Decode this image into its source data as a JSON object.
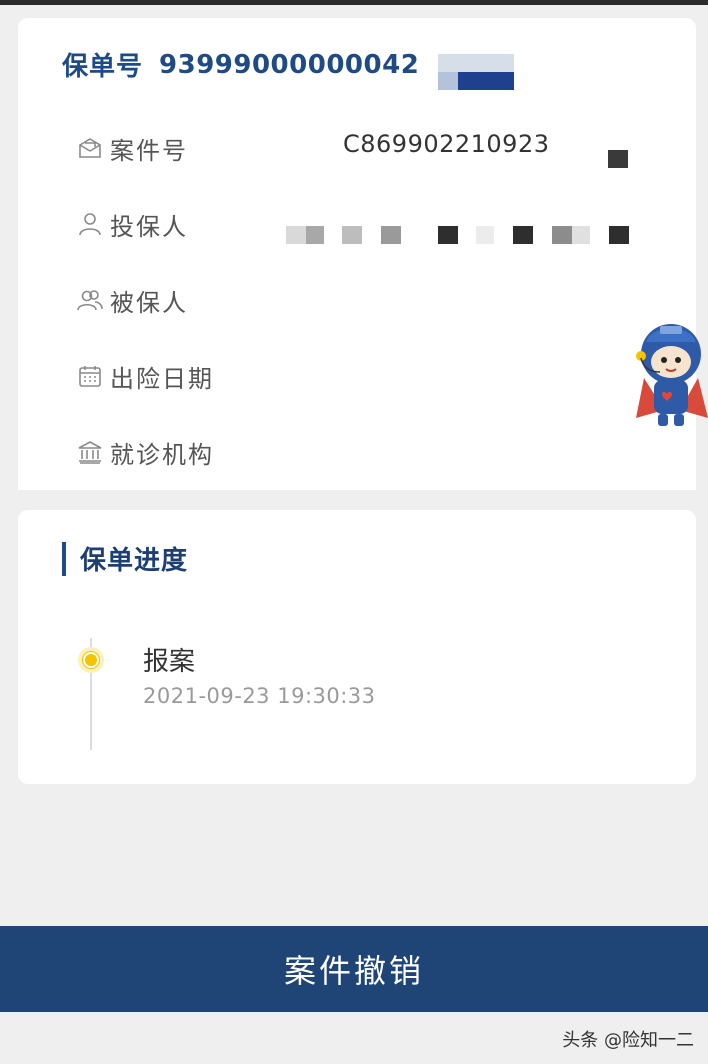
{
  "policy": {
    "label": "保单号",
    "number": "93999000000042"
  },
  "fields": [
    {
      "label": "案件号",
      "icon": "envelope-icon"
    },
    {
      "label": "投保人",
      "icon": "person-icon"
    },
    {
      "label": "被保人",
      "icon": "people-icon"
    },
    {
      "label": "出险日期",
      "icon": "calendar-icon"
    },
    {
      "label": "就诊机构",
      "icon": "bank-icon"
    }
  ],
  "case_number": "C869902210923",
  "progress": {
    "title": "保单进度",
    "events": [
      {
        "title": "报案",
        "time": "2021-09-23 19:30:33"
      }
    ]
  },
  "actions": {
    "cancel_case": "案件撤销"
  },
  "watermark": "头条 @险知一二",
  "colors": {
    "brand_blue": "#1f4577",
    "title_blue": "#1e4a86",
    "timeline_dot": "#f5c400",
    "background": "#efefef"
  }
}
